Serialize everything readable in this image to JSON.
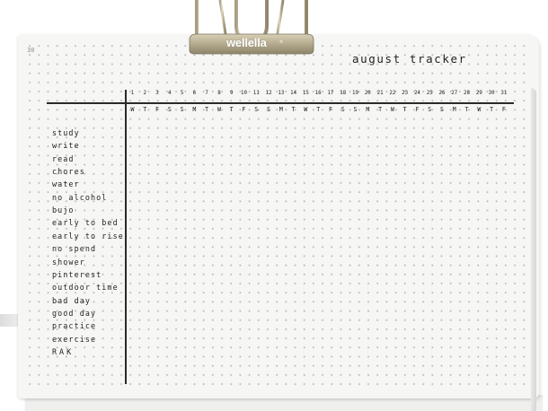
{
  "page_number": "30",
  "title": "august tracker",
  "binder_clip": {
    "brand": "wellella",
    "trademark": "®",
    "color": "#c9c0a4"
  },
  "days": [
    "1",
    "2",
    "3",
    "4",
    "5",
    "6",
    "7",
    "8",
    "9",
    "10",
    "11",
    "12",
    "13",
    "14",
    "15",
    "16",
    "17",
    "18",
    "19",
    "20",
    "21",
    "22",
    "23",
    "24",
    "25",
    "26",
    "27",
    "28",
    "29",
    "30",
    "31"
  ],
  "weekdays": [
    "W",
    "T",
    "F",
    "S",
    "S",
    "M",
    "T",
    "W",
    "T",
    "F",
    "S",
    "S",
    "M",
    "T",
    "W",
    "T",
    "F",
    "S",
    "S",
    "M",
    "T",
    "W",
    "T",
    "F",
    "S",
    "S",
    "M",
    "T",
    "W",
    "T",
    "F"
  ],
  "habits": [
    "study",
    "write",
    "read",
    "chores",
    "water",
    "no alcohol",
    "bujo",
    "early to bed",
    "early to rise",
    "no spend",
    "shower",
    "pinterest",
    "outdoor time",
    "bad day",
    "good day",
    "practice",
    "exercise",
    "RAK"
  ],
  "colors": {
    "ink": "#222222",
    "paper": "#f6f6f5",
    "dots": "#b9b9b9"
  }
}
